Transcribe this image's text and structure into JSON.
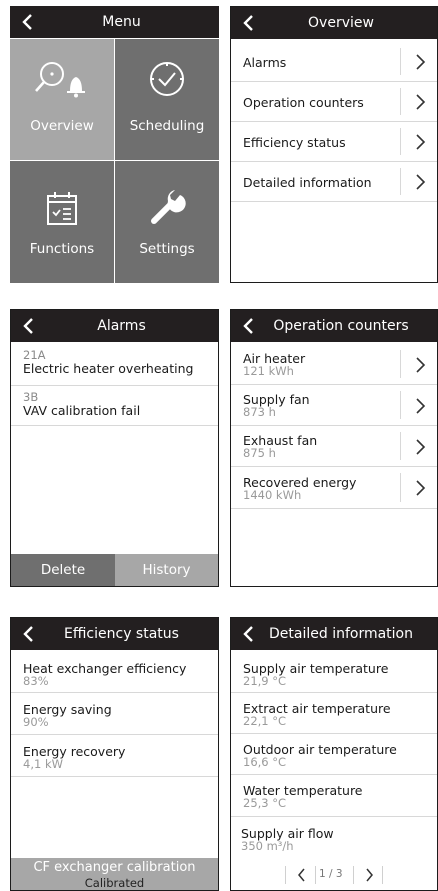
{
  "menu": {
    "title": "Menu",
    "tiles": [
      {
        "label": "Overview",
        "icon": "search-alarm-icon",
        "color": "#a7a7a7"
      },
      {
        "label": "Scheduling",
        "icon": "clock-icon",
        "color": "#6f6f6f"
      },
      {
        "label": "Functions",
        "icon": "calendar-icon",
        "color": "#6f6f6f"
      },
      {
        "label": "Settings",
        "icon": "wrench-icon",
        "color": "#6f6f6f"
      }
    ]
  },
  "overview": {
    "title": "Overview",
    "items": [
      {
        "label": "Alarms"
      },
      {
        "label": "Operation counters"
      },
      {
        "label": "Efficiency status"
      },
      {
        "label": "Detailed information"
      }
    ]
  },
  "alarms": {
    "title": "Alarms",
    "items": [
      {
        "code": "21A",
        "message": "Electric heater overheating"
      },
      {
        "code": "3B",
        "message": "VAV calibration fail"
      }
    ],
    "delete_label": "Delete",
    "history_label": "History"
  },
  "counters": {
    "title": "Operation counters",
    "items": [
      {
        "label": "Air heater",
        "value": "121 kWh"
      },
      {
        "label": "Supply fan",
        "value": "873 h"
      },
      {
        "label": "Exhaust fan",
        "value": "875 h"
      },
      {
        "label": "Recovered energy",
        "value": "1440 kWh"
      }
    ]
  },
  "efficiency": {
    "title": "Efficiency status",
    "items": [
      {
        "label": "Heat exchanger efficiency",
        "value": "83%"
      },
      {
        "label": "Energy saving",
        "value": "90%"
      },
      {
        "label": "Energy recovery",
        "value": "4,1 kW"
      }
    ],
    "calibration_label": "CF exchanger calibration",
    "calibration_status": "Calibrated"
  },
  "detailed": {
    "title": "Detailed information",
    "items": [
      {
        "label": "Supply air temperature",
        "value": "21,9 °C"
      },
      {
        "label": "Extract air temperature",
        "value": "22,1 °C"
      },
      {
        "label": "Outdoor air temperature",
        "value": "16,6 °C"
      },
      {
        "label": "Water temperature",
        "value": "25,3 °C"
      },
      {
        "label": "Supply air flow",
        "value": "350 m³/h"
      }
    ],
    "page_indicator": "1 / 3"
  },
  "colors": {
    "header": "#231f20",
    "tile_dark": "#6f6f6f",
    "tile_light": "#a7a7a7",
    "value_gray": "#9a9a9a"
  }
}
